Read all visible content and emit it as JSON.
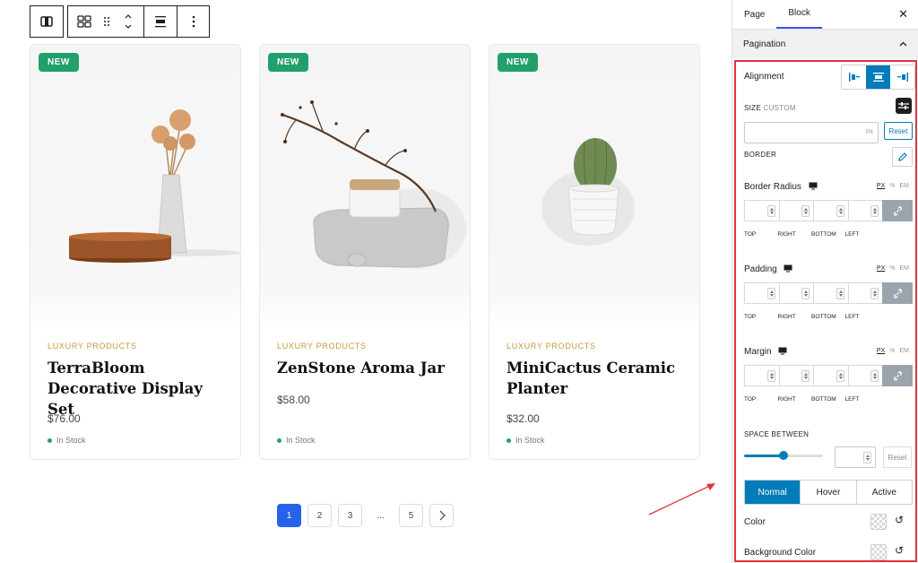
{
  "products": [
    {
      "badge": "NEW",
      "category": "LUXURY PRODUCTS",
      "title": "TerraBloom Decorative Display Set",
      "price": "$76.00",
      "stock": "In Stock"
    },
    {
      "badge": "NEW",
      "category": "LUXURY PRODUCTS",
      "title": "ZenStone Aroma Jar",
      "price": "$58.00",
      "stock": "In Stock"
    },
    {
      "badge": "NEW",
      "category": "LUXURY PRODUCTS",
      "title": "MiniCactus Ceramic Planter",
      "price": "$32.00",
      "stock": "In Stock"
    }
  ],
  "pagination": {
    "pages": [
      "1",
      "2",
      "3",
      "...",
      "5"
    ],
    "active": "1",
    "next_icon": "chevron-right-icon"
  },
  "toolbar": {
    "icons": [
      "block-type-icon",
      "grid-icon",
      "drag-handle-icon",
      "move-up-down-icon",
      "align-icon",
      "more-options-icon"
    ]
  },
  "sidebar": {
    "tabs": [
      "Page",
      "Block"
    ],
    "active_tab": "Block",
    "section_title": "Pagination",
    "alignment_label": "Alignment",
    "alignment_options": [
      "left",
      "center",
      "right"
    ],
    "alignment_active": "center",
    "size_label": "SIZE",
    "size_mode": "CUSTOM",
    "size_value": "",
    "size_unit": "PX",
    "reset_label": "Reset",
    "border_label": "BORDER",
    "border_radius_label": "Border Radius",
    "padding_label": "Padding",
    "margin_label": "Margin",
    "units": [
      "PX",
      "%",
      "EM"
    ],
    "active_unit": "PX",
    "sides": [
      "TOP",
      "RIGHT",
      "BOTTOM",
      "LEFT"
    ],
    "space_between_label": "SPACE BETWEEN",
    "space_between_value": 0.5,
    "space_reset_label": "Reset",
    "states": [
      "Normal",
      "Hover",
      "Active"
    ],
    "active_state": "Normal",
    "color_label": "Color",
    "background_color_label": "Background Color"
  },
  "colors": {
    "accent": "#007cba",
    "badge": "#22a06b",
    "pagination_active": "#2563eb",
    "highlight": "#e3343c",
    "category": "#c49a3a"
  }
}
